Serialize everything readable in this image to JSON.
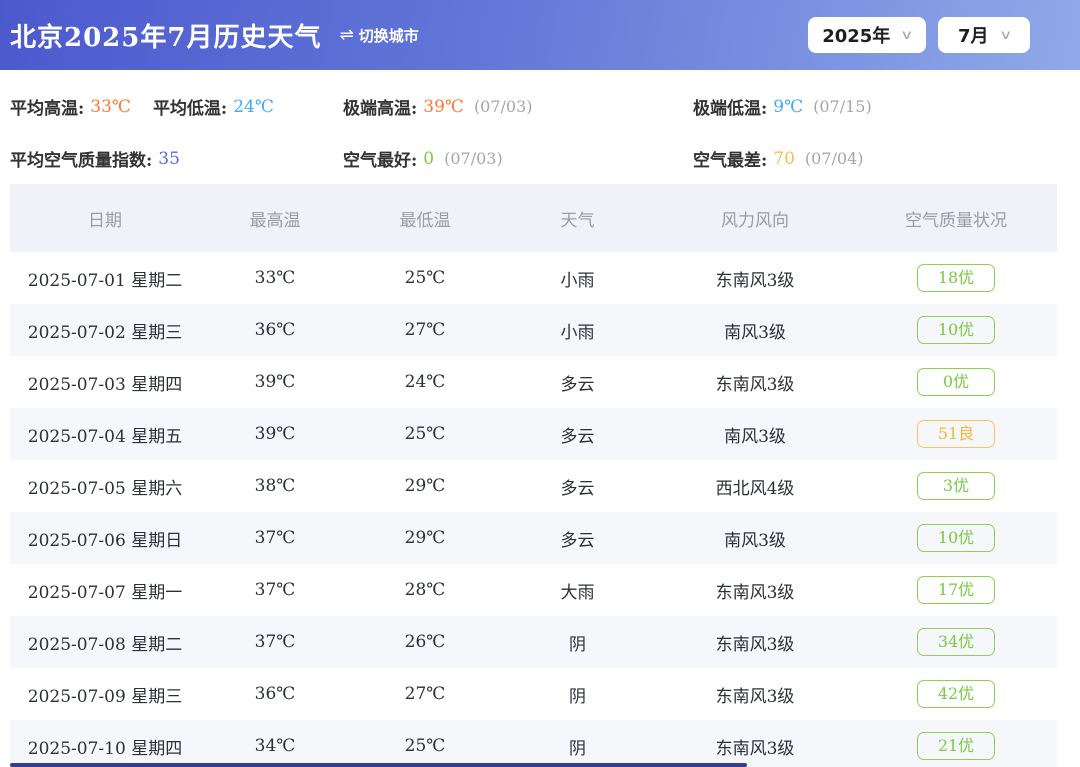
{
  "header": {
    "title": "北京2025年7月历史天气",
    "switch_city_icon": "⇌",
    "switch_city_label": "切换城市",
    "year_selected": "2025年",
    "month_selected": "7月",
    "chevron": "∨"
  },
  "stats": {
    "avg_high": {
      "label": "平均高温:",
      "value": "33℃"
    },
    "avg_low": {
      "label": "平均低温:",
      "value": "24℃"
    },
    "extreme_high": {
      "label": "极端高温:",
      "value": "39℃",
      "date": "(07/03)"
    },
    "extreme_low": {
      "label": "极端低温:",
      "value": "9℃",
      "date": "(07/15)"
    },
    "avg_aqi": {
      "label": "平均空气质量指数:",
      "value": "35"
    },
    "best_air": {
      "label": "空气最好:",
      "value": "0",
      "date": "(07/03)"
    },
    "worst_air": {
      "label": "空气最差:",
      "value": "70",
      "date": "(07/04)"
    }
  },
  "colors": {
    "banner_gradient_left": "#4c59ce",
    "banner_gradient_right": "#8fa9e8",
    "high_temp": "#ff7733",
    "low_temp": "#3fa8ff",
    "avg_aqi": "#5b6ade",
    "aqi_good_green": "#7bc944",
    "aqi_fine_amber": "#f4b73a",
    "scrollbar_thumb": "#333d94"
  },
  "table": {
    "columns": [
      "日期",
      "最高温",
      "最低温",
      "天气",
      "风力风向",
      "空气质量状况"
    ],
    "rows": [
      {
        "date": "2025-07-01 星期二",
        "high": "33℃",
        "low": "25℃",
        "weather": "小雨",
        "wind": "东南风3级",
        "aqi": "18优",
        "aqi_level": "good"
      },
      {
        "date": "2025-07-02 星期三",
        "high": "36℃",
        "low": "27℃",
        "weather": "小雨",
        "wind": "南风3级",
        "aqi": "10优",
        "aqi_level": "good"
      },
      {
        "date": "2025-07-03 星期四",
        "high": "39℃",
        "low": "24℃",
        "weather": "多云",
        "wind": "东南风3级",
        "aqi": "0优",
        "aqi_level": "good"
      },
      {
        "date": "2025-07-04 星期五",
        "high": "39℃",
        "low": "25℃",
        "weather": "多云",
        "wind": "南风3级",
        "aqi": "51良",
        "aqi_level": "fine"
      },
      {
        "date": "2025-07-05 星期六",
        "high": "38℃",
        "low": "29℃",
        "weather": "多云",
        "wind": "西北风4级",
        "aqi": "3优",
        "aqi_level": "good"
      },
      {
        "date": "2025-07-06 星期日",
        "high": "37℃",
        "low": "29℃",
        "weather": "多云",
        "wind": "南风3级",
        "aqi": "10优",
        "aqi_level": "good"
      },
      {
        "date": "2025-07-07 星期一",
        "high": "37℃",
        "low": "28℃",
        "weather": "大雨",
        "wind": "东南风3级",
        "aqi": "17优",
        "aqi_level": "good"
      },
      {
        "date": "2025-07-08 星期二",
        "high": "37℃",
        "low": "26℃",
        "weather": "阴",
        "wind": "东南风3级",
        "aqi": "34优",
        "aqi_level": "good"
      },
      {
        "date": "2025-07-09 星期三",
        "high": "36℃",
        "low": "27℃",
        "weather": "阴",
        "wind": "东南风3级",
        "aqi": "42优",
        "aqi_level": "good"
      },
      {
        "date": "2025-07-10 星期四",
        "high": "34℃",
        "low": "25℃",
        "weather": "阴",
        "wind": "东南风3级",
        "aqi": "21优",
        "aqi_level": "good"
      }
    ]
  }
}
